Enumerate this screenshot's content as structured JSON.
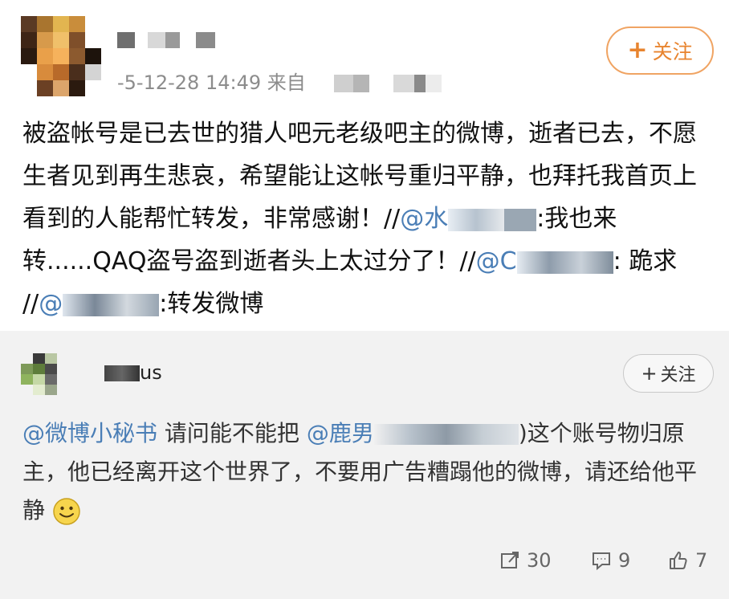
{
  "post": {
    "author_name": "",
    "time": "-5-12-28 14:49",
    "source_label": "来自",
    "follow_label": "关注",
    "text": {
      "p1": "被盗帐号是已去世的猎人吧元老级吧主的微博，逝者已去，不愿生者见到再生悲哀，希望能让这帐号重归平静，也拜托我首页上看到的人能帮忙转发，非常感谢！",
      "s1": "//",
      "m1": "@水",
      "t1": ":我也来转......QAQ盗号盗到逝者头上太过分了！",
      "s2": "//",
      "m2": "@C",
      "t2": ": 跪求",
      "s3": "//",
      "m3": "@",
      "t3": ":转发微博"
    }
  },
  "reply": {
    "author_suffix": "us",
    "follow_label": "关注",
    "mention1": "@微博小秘书",
    "text1": " 请问能不能把 ",
    "mention2": "@鹿男",
    "text2": ")这个账号物归原主，他已经离开这个世界了，不要用广告糟蹋他的微博，请还给他平静"
  },
  "actions": {
    "repost_count": "30",
    "comment_count": "9",
    "like_count": "7"
  },
  "colors": {
    "follow_orange": "#e8842f",
    "link_blue": "#4a7eb6",
    "grey_bg": "#f2f2f2"
  },
  "icons": [
    "repost-icon",
    "comment-icon",
    "like-icon",
    "smiley-emoji"
  ]
}
